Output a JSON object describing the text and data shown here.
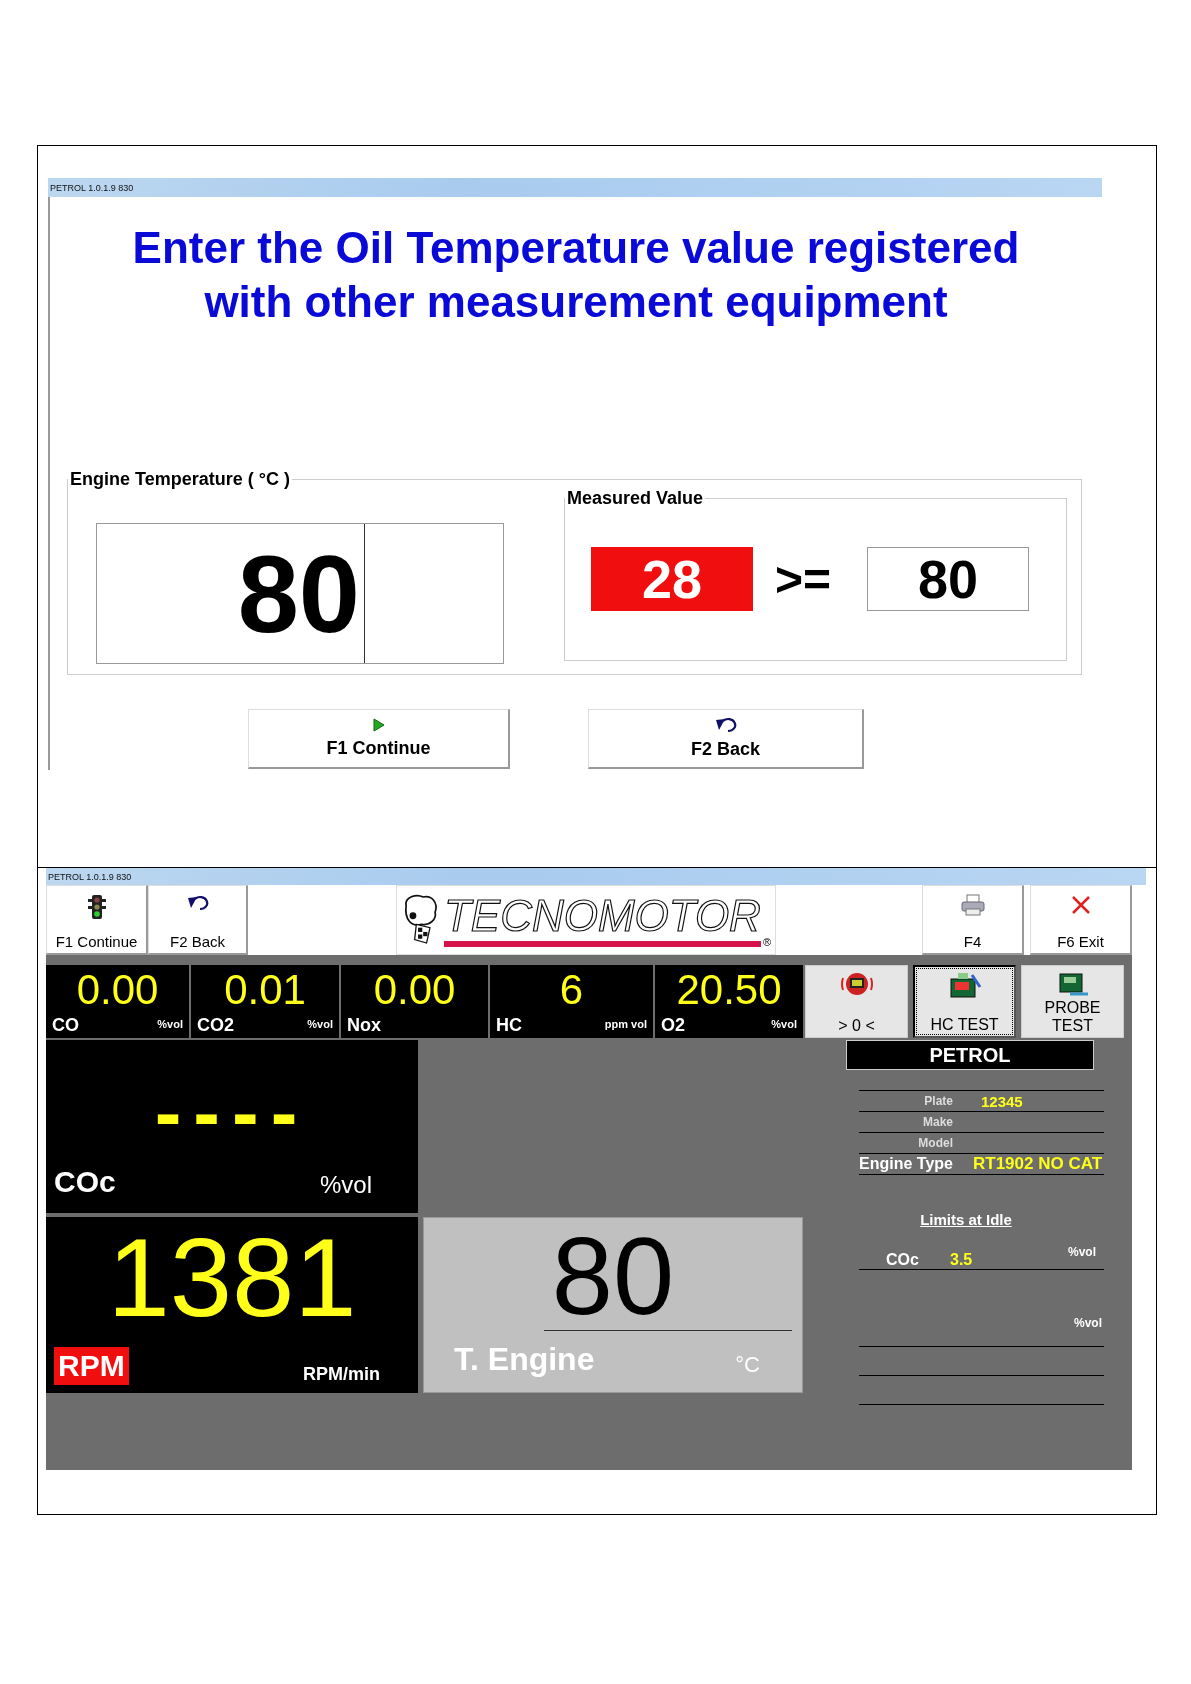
{
  "screen_1": {
    "title_bar": "PETROL 1.0.1.9  830",
    "heading": [
      "Enter the Oil Temperature value registered",
      "with other measurement equipment"
    ],
    "engine_temperature": {
      "label": "Engine Temperature ( °C )",
      "value": "80"
    },
    "measured_value": {
      "label": "Measured Value",
      "reading": "28",
      "alarm": true,
      "operator": ">=",
      "threshold": "80"
    },
    "buttons": [
      {
        "label": "F1 Continue",
        "kind": "play"
      },
      {
        "label": "F2 Back",
        "kind": "undo"
      }
    ]
  },
  "screen_2": {
    "title_bar": "PETROL 1.0.1.9  830",
    "toolbar_left": [
      {
        "label": "F1 Continue",
        "kind": "traffic"
      },
      {
        "label": "F2 Back",
        "kind": "undo"
      }
    ],
    "logo": {
      "text": "TECNOMOTOR",
      "mark": "®"
    },
    "toolbar_right": [
      {
        "label": "F4",
        "kind": "printer"
      },
      {
        "label": "F6 Exit",
        "kind": "close"
      }
    ],
    "readings": [
      {
        "value": "0.00",
        "name": "CO",
        "unit": "%vol"
      },
      {
        "value": "0.01",
        "name": "CO2",
        "unit": "%vol"
      },
      {
        "value": "0.00",
        "name": "Nox"
      },
      {
        "value": "6",
        "name": "HC",
        "unit": "ppm vol"
      },
      {
        "value": "20.50",
        "name": "O2",
        "unit": "%vol"
      }
    ],
    "actions": [
      {
        "label": "> 0 <",
        "kind": "zero",
        "pressed": false
      },
      {
        "label": "HC TEST",
        "kind": "hc",
        "pressed": true
      },
      {
        "label": "PROBE TEST",
        "kind": "probe",
        "pressed": false
      }
    ],
    "coc": {
      "value": "----",
      "name": "COc",
      "unit": "%vol"
    },
    "rpm": {
      "value": "1381",
      "badge": "RPM",
      "unit": "RPM/min"
    },
    "engine": {
      "value": "80",
      "label": "T. Engine",
      "unit": "°C"
    },
    "fuel": "PETROL",
    "vehicle": [
      {
        "label": "Plate",
        "value": "12345",
        "major": false
      },
      {
        "label": "Make",
        "major": false
      },
      {
        "label": "Model",
        "major": false
      },
      {
        "label": "Engine Type",
        "value": "RT1902 NO CAT",
        "major": true
      }
    ],
    "limits_title": "Limits at Idle",
    "limits": [
      {
        "name": "COc",
        "value": "3.5",
        "unit": "%vol"
      },
      {
        "unit": "%vol"
      }
    ]
  }
}
